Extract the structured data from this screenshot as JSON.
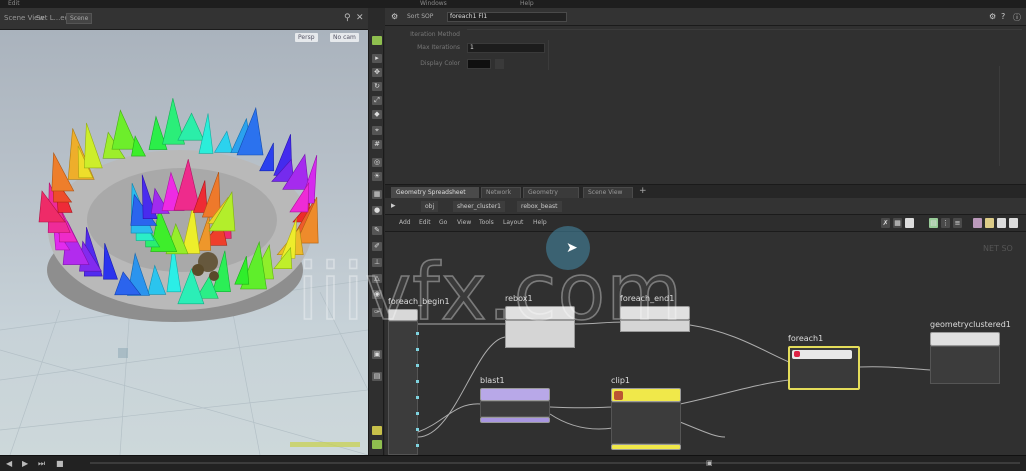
{
  "top_strip": {
    "left": "Edit",
    "mid": "Windows",
    "right": "Help"
  },
  "viewport": {
    "title": "Scene View",
    "subtitle": "Set L...ed",
    "button": "Scene",
    "tags": [
      "Persp",
      "No cam"
    ],
    "icons": {
      "pin": "pin-icon",
      "close": "close-icon"
    }
  },
  "param_panel": {
    "label": "Sort SOP",
    "node_name": "foreach1 Fl1",
    "rows": [
      {
        "label": "Iteration Method",
        "value": ""
      },
      {
        "label": "Max Iterations",
        "value": "1"
      },
      {
        "label": "Display Color",
        "value": ""
      }
    ]
  },
  "network": {
    "tabs": [
      "Geometry Spreadsheet",
      "Network",
      "Geometry Wrangle",
      "Scene View"
    ],
    "path": [
      "obj",
      "sheer_cluster1",
      "rebox_beast"
    ],
    "menu": [
      "Add",
      "Edit",
      "Go",
      "View",
      "Tools",
      "Layout",
      "Help"
    ],
    "corner_label": "NET SO",
    "nodes": {
      "n1": {
        "title": "foreach_begin1",
        "type": ""
      },
      "n2": {
        "title": "rebox1",
        "type": ""
      },
      "n3": {
        "title": "foreach_end1",
        "type": ""
      },
      "n4": {
        "title": "foreach1",
        "type": ""
      },
      "n5": {
        "title": "geometryclustered1",
        "type": ""
      },
      "n6": {
        "title": "blast1",
        "type": ""
      },
      "n7": {
        "title": "clip1",
        "type": ""
      }
    }
  },
  "watermark": "iiivfx.com"
}
